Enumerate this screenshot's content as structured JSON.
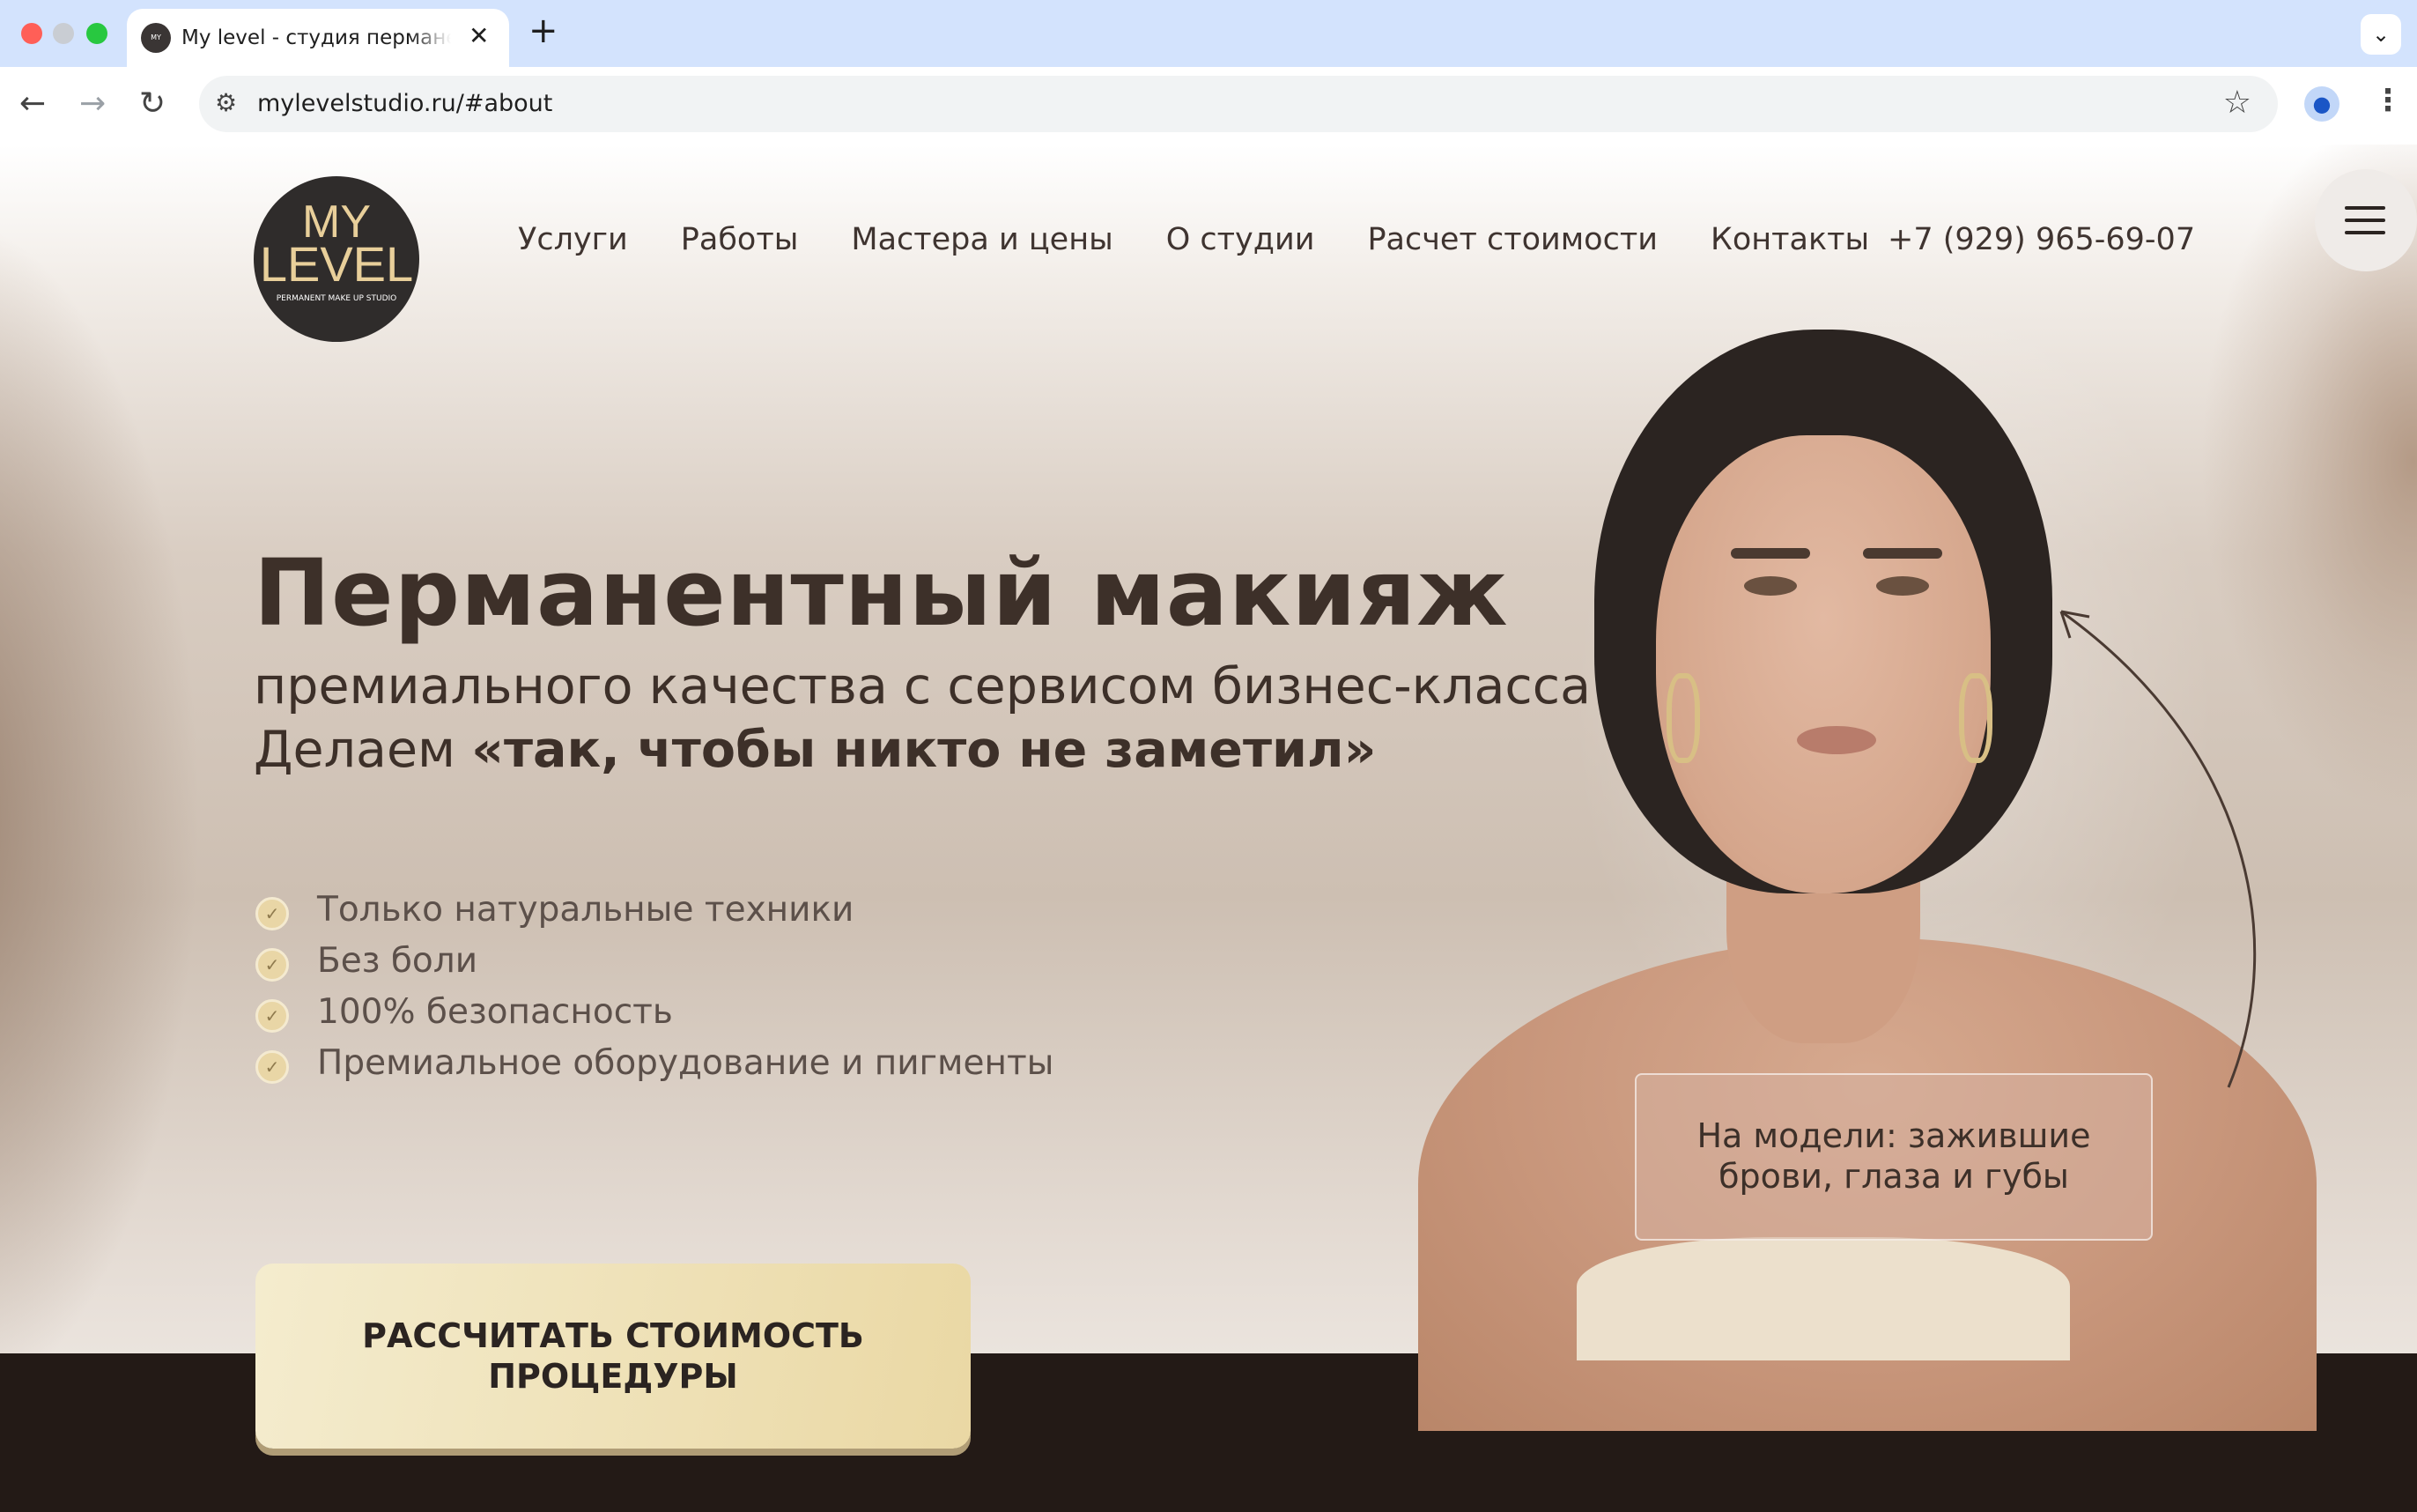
{
  "browser": {
    "tab_title": "My level - студия перманентного макияжа",
    "favicon_text": "MY LEVEL",
    "tab_close": "✕",
    "new_tab": "+",
    "tab_dropdown": "⌄",
    "url": "mylevelstudio.ru/#about",
    "back": "←",
    "forward": "→",
    "reload": "↻",
    "site_info": "⚙",
    "star": "☆",
    "profile": "●",
    "menu": "⋮"
  },
  "header": {
    "logo": {
      "line1": "MY",
      "line2": "LEVEL",
      "sub": "PERMANENT MAKE UP STUDIO"
    },
    "nav": [
      "Услуги",
      "Работы",
      "Мастера и цены",
      "О студии",
      "Расчет стоимости",
      "Контакты"
    ],
    "phone": "+7 (929) 965-69-07"
  },
  "hero": {
    "title": "Перманентный макияж",
    "subtitle": "премиального качества с сервисом бизнес-класса",
    "tagline_prefix": "Делаем ",
    "tagline_bold": "«так, чтобы никто не заметил»",
    "features": [
      "Только натуральные техники",
      "Без боли",
      "100% безопасность",
      "Премиальное оборудование и пигменты"
    ],
    "cta": {
      "line1": "РАССЧИТАТЬ СТОИМОСТЬ",
      "line2": "ПРОЦЕДУРЫ"
    },
    "caption": {
      "line1": "На модели: зажившие",
      "line2": "брови, глаза и губы"
    }
  },
  "colors": {
    "tabstrip": "#d3e3fd",
    "text_dark": "#3d3029",
    "cta_gold": "#ead8a4",
    "footer_band": "#231a16"
  },
  "icons": {
    "check": "check-icon",
    "burger": "hamburger-menu-icon",
    "arrow": "curved-arrow-icon"
  }
}
